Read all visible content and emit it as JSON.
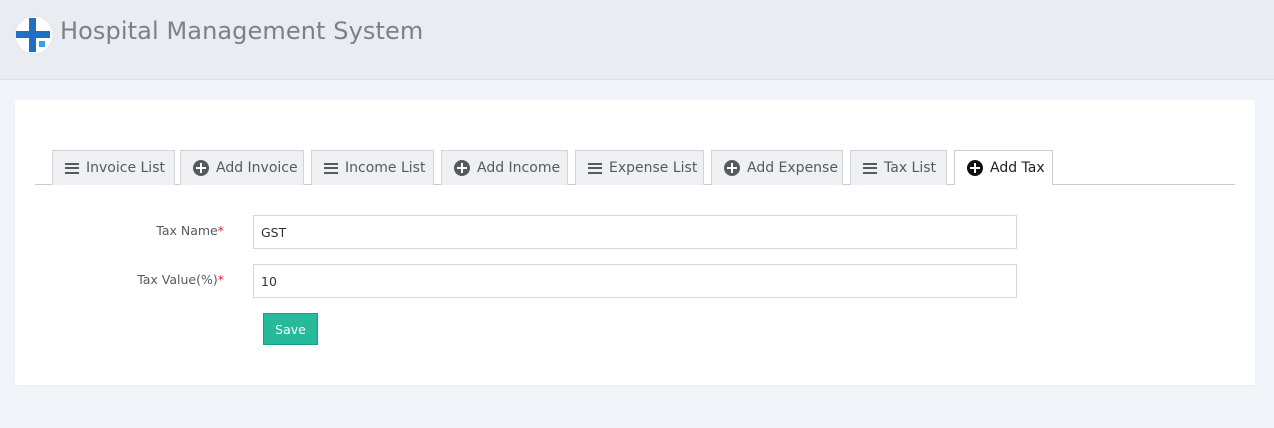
{
  "header": {
    "title": "Hospital Management System",
    "logo_icon": "medical-cross-logo"
  },
  "tabs": [
    {
      "label": "Invoice List",
      "icon": "list-icon",
      "active": false
    },
    {
      "label": "Add Invoice",
      "icon": "plus-circle-icon",
      "active": false
    },
    {
      "label": "Income List",
      "icon": "list-icon",
      "active": false
    },
    {
      "label": "Add Income",
      "icon": "plus-circle-icon",
      "active": false
    },
    {
      "label": "Expense List",
      "icon": "list-icon",
      "active": false
    },
    {
      "label": "Add Expense",
      "icon": "plus-circle-icon",
      "active": false
    },
    {
      "label": "Tax List",
      "icon": "list-icon",
      "active": false
    },
    {
      "label": "Add Tax",
      "icon": "plus-circle-icon",
      "active": true
    }
  ],
  "form": {
    "tax_name_label": "Tax Name",
    "tax_name_value": "GST",
    "tax_value_label": "Tax Value(%)",
    "tax_value_value": "10",
    "required_marker": "*",
    "save_label": "Save"
  },
  "colors": {
    "accent_button": "#26b99a",
    "required": "#d9262c",
    "logo_blue": "#1f6fc2"
  }
}
